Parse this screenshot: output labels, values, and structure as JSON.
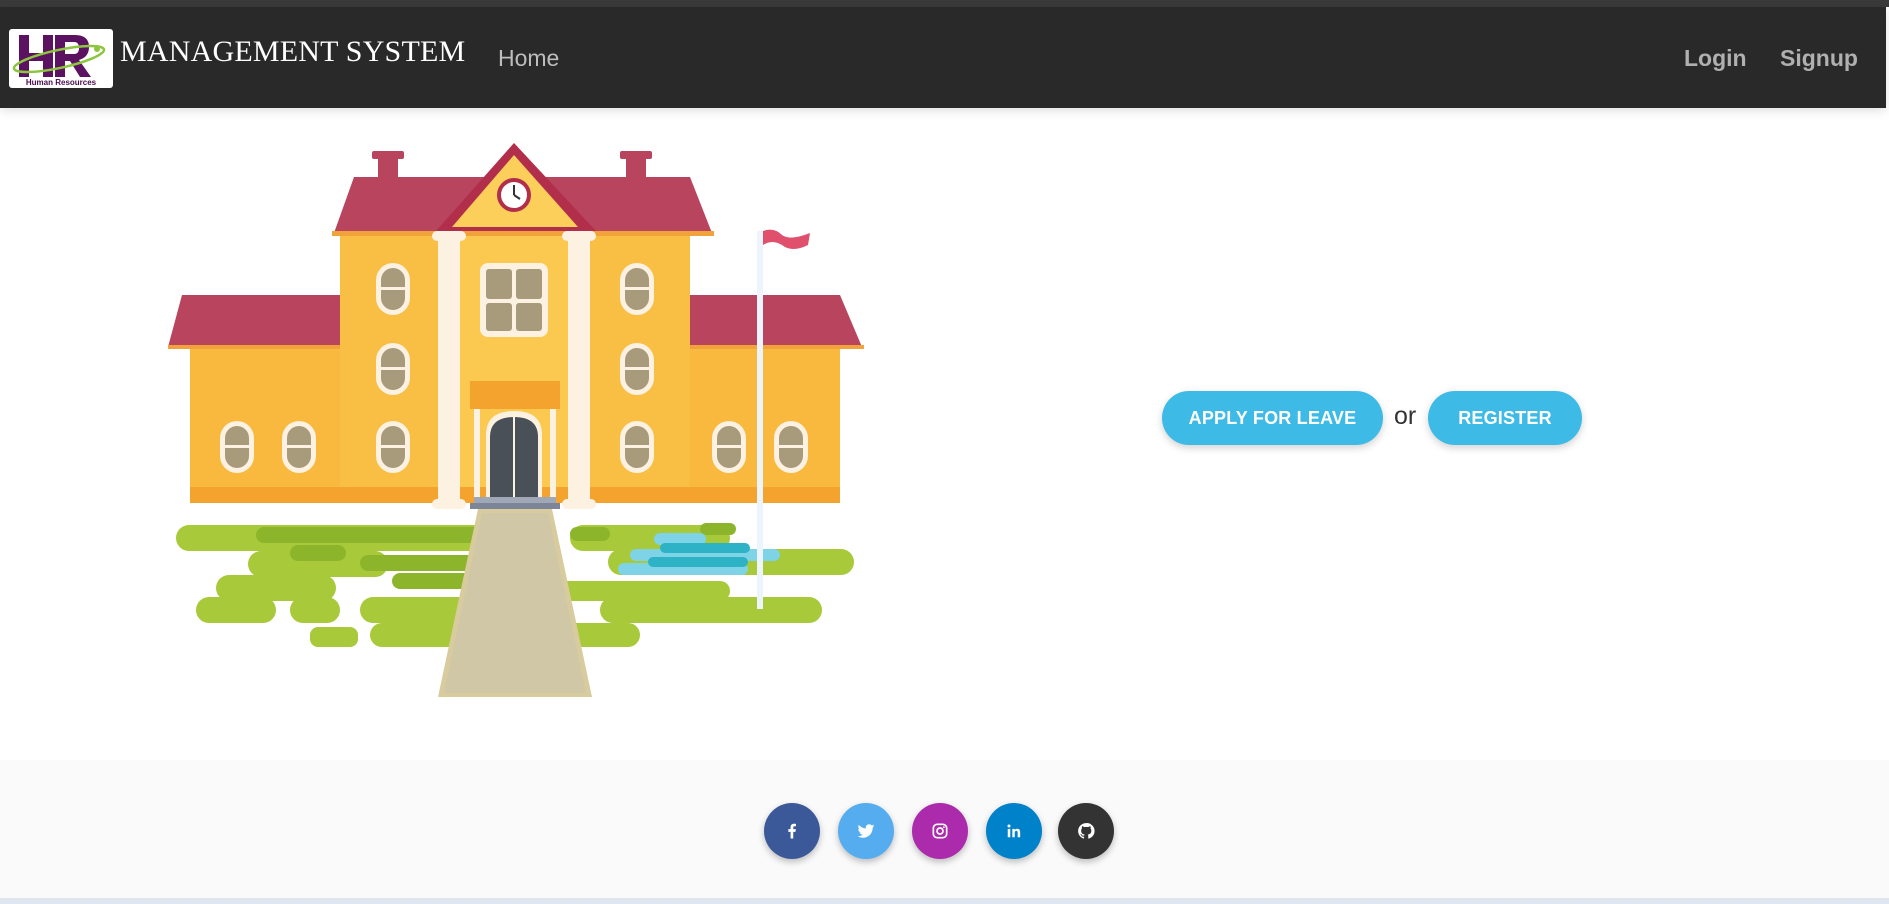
{
  "navbar": {
    "logo_text": "Human Resources",
    "brand": "MANAGEMENT SYSTEM",
    "home_label": "Home",
    "login_label": "Login",
    "signup_label": "Signup"
  },
  "hero": {
    "apply_label": "APPLY FOR LEAVE",
    "or_text": "or",
    "register_label": "REGISTER"
  },
  "footer": {
    "social_icons": [
      {
        "name": "facebook-icon",
        "color": "#3b5998"
      },
      {
        "name": "twitter-icon",
        "color": "#55acee"
      },
      {
        "name": "instagram-icon",
        "color": "#ac2bac"
      },
      {
        "name": "linkedin-icon",
        "color": "#0082ca"
      },
      {
        "name": "github-icon",
        "color": "#333333"
      }
    ]
  },
  "colors": {
    "navbar_bg": "#292929",
    "button_accent": "#3dbbe6",
    "footer_bg": "#fafafa"
  }
}
